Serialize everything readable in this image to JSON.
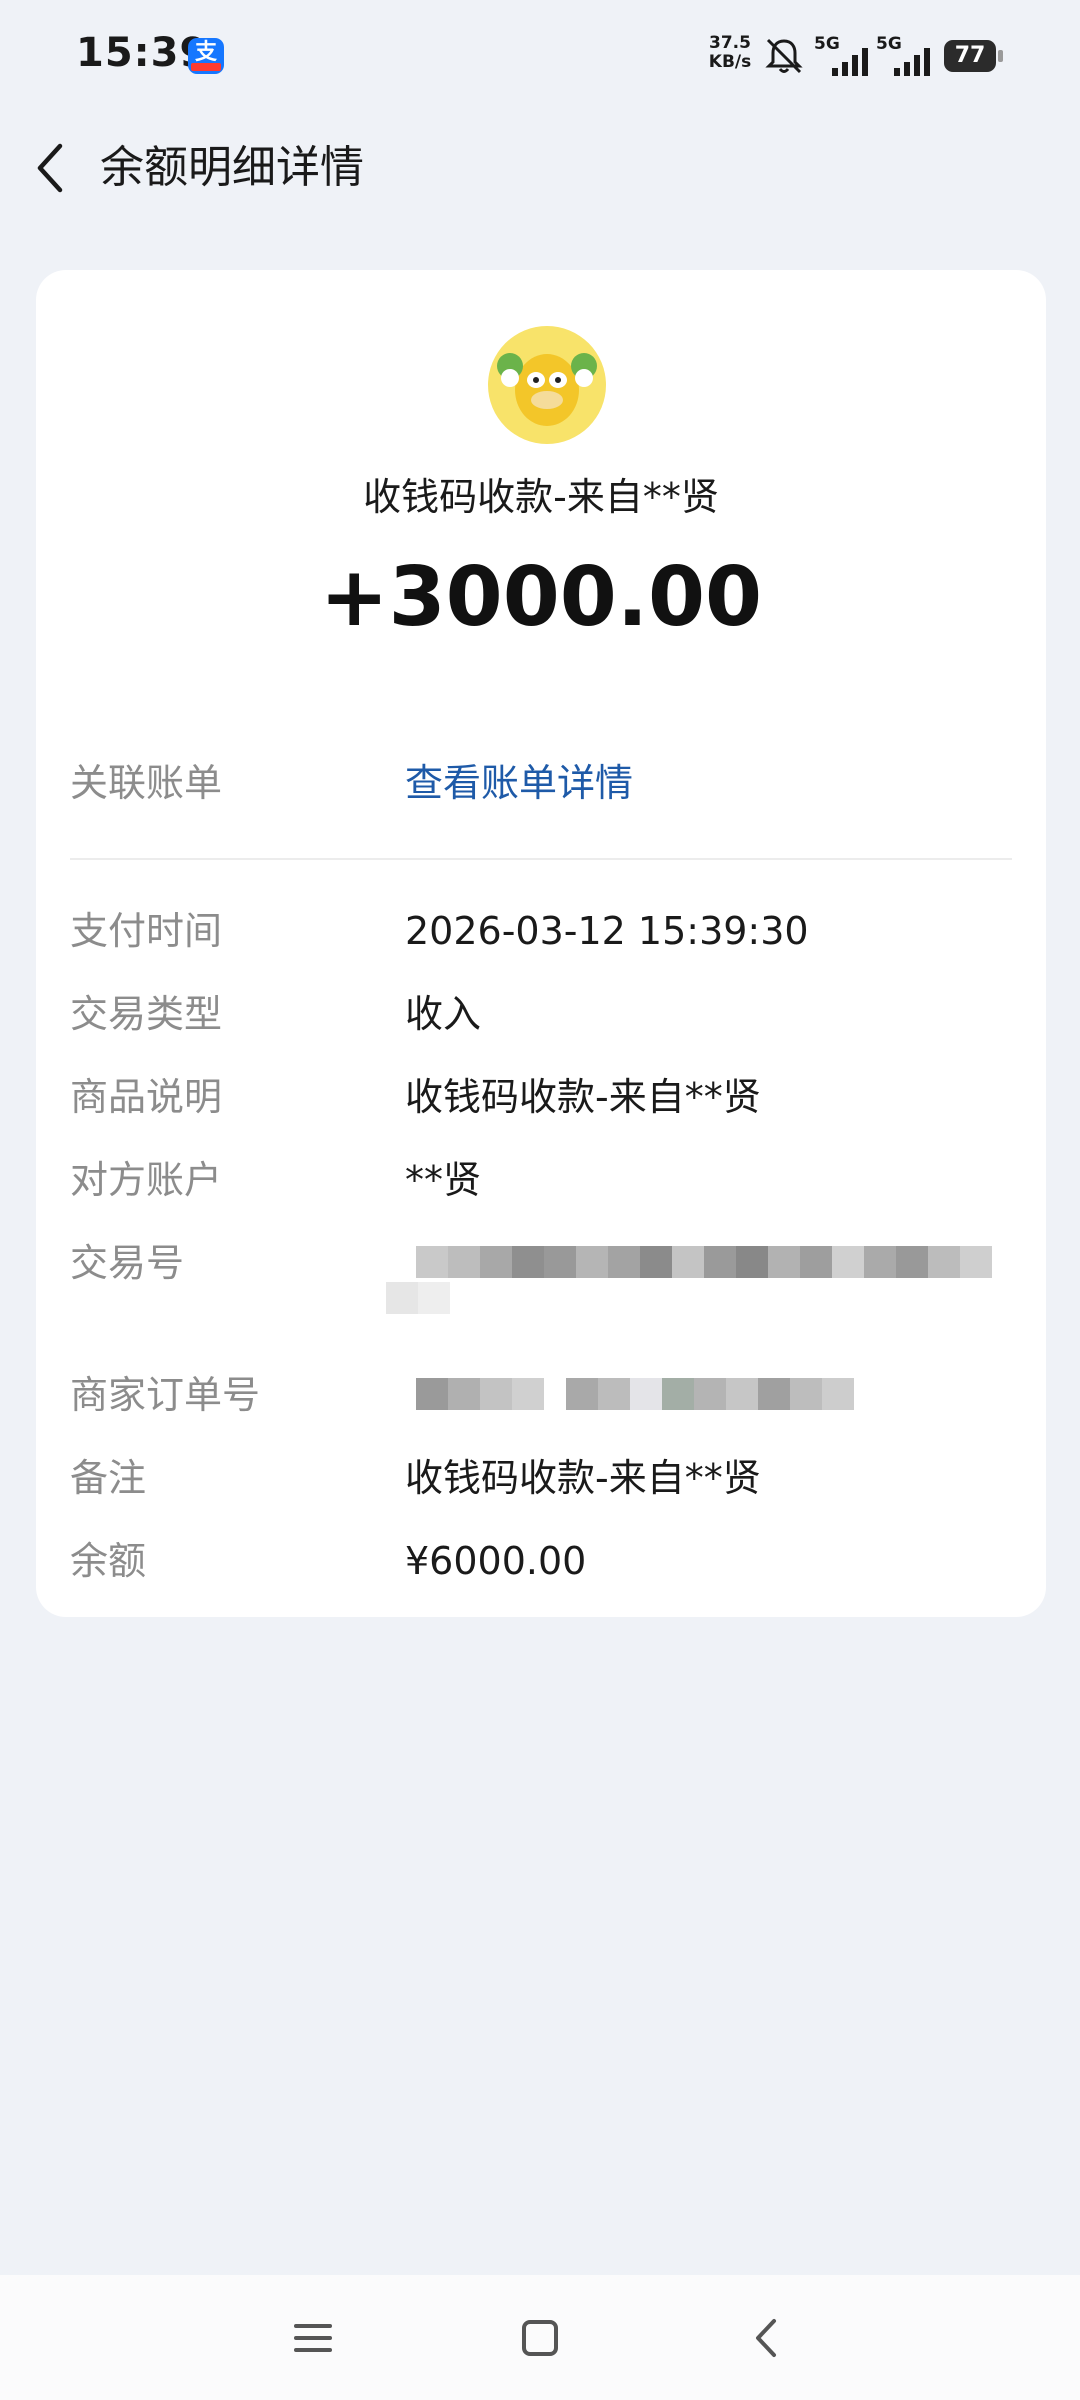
{
  "status_bar": {
    "time": "15:39",
    "app_badge": "支",
    "net_speed_value": "37.5",
    "net_speed_unit": "KB/s",
    "signal_1": "5G",
    "signal_2": "5G",
    "battery": "77"
  },
  "header": {
    "title": "余额明细详情"
  },
  "card": {
    "trade_title": "收钱码收款-来自**贤",
    "amount": "+3000.00",
    "linked_bill_label": "关联账单",
    "linked_bill_link": "查看账单详情",
    "details": {
      "pay_time_label": "支付时间",
      "pay_time": "2026-03-12 15:39:30",
      "trade_type_label": "交易类型",
      "trade_type": "收入",
      "goods_desc_label": "商品说明",
      "goods_desc": "收钱码收款-来自**贤",
      "counterparty_label": "对方账户",
      "counterparty": "**贤",
      "trade_no_label": "交易号",
      "merchant_order_label": "商家订单号",
      "remark_label": "备注",
      "remark": "收钱码收款-来自**贤",
      "balance_label": "余额",
      "balance": "¥6000.00"
    }
  },
  "colors": {
    "background": "#eff2f7",
    "link": "#1e5aa8",
    "label": "#8c8c8c"
  },
  "icons": {
    "back": "back-chevron-icon",
    "menu": "menu-icon",
    "home": "home-icon",
    "nav_back": "nav-back-icon"
  }
}
